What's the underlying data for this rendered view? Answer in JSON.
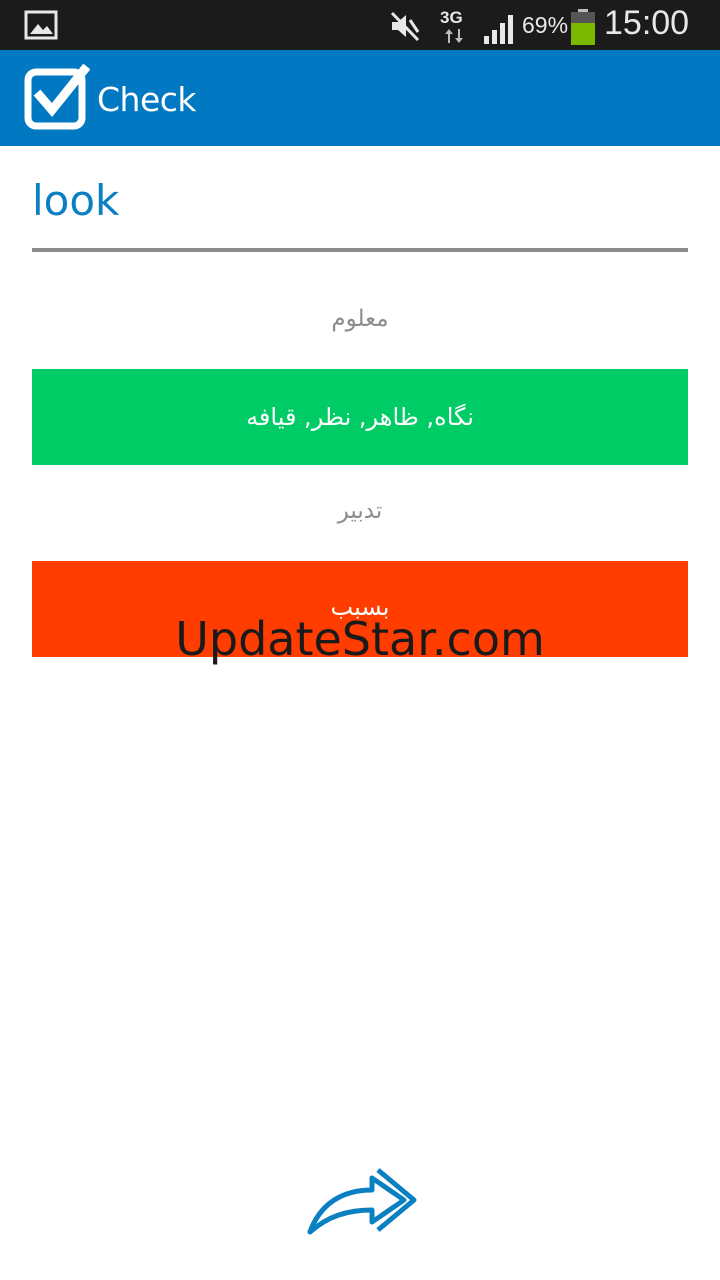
{
  "status_bar": {
    "network_type": "3G",
    "battery_percent": "69%",
    "time": "15:00",
    "icons": [
      "gallery-icon",
      "mute-icon",
      "data-arrows-icon",
      "signal-icon",
      "battery-icon"
    ],
    "battery_color": "#7cb800"
  },
  "action_bar": {
    "title": "Check",
    "background_color": "#0078c2",
    "logo_icon": "checkbox-check-icon"
  },
  "main": {
    "word": "look",
    "options": [
      {
        "label": "معلوم",
        "answer": "نگاه, ظاهر, نظر, قیافه",
        "color": "#00cc66"
      },
      {
        "label": "تدبیر",
        "answer": "بسبب",
        "color": "#ff3d00"
      }
    ]
  },
  "watermark": "UpdateStar.com",
  "footer": {
    "next_icon": "forward-arrow-icon"
  }
}
